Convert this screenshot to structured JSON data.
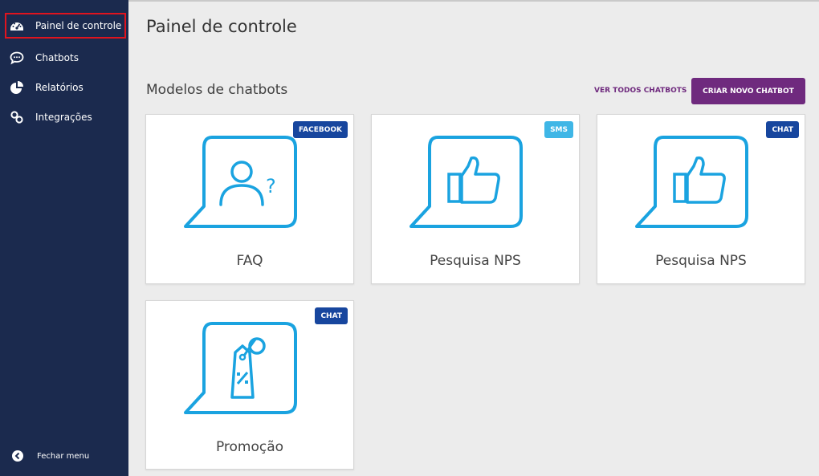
{
  "sidebar": {
    "items": [
      {
        "label": "Painel de controle",
        "icon": "dashboard-icon",
        "active": true
      },
      {
        "label": "Chatbots",
        "icon": "chat-bubble-icon",
        "active": false
      },
      {
        "label": "Relatórios",
        "icon": "pie-chart-icon",
        "active": false
      },
      {
        "label": "Integrações",
        "icon": "link-icon",
        "active": false
      }
    ],
    "close_menu": "Fechar menu"
  },
  "main": {
    "title": "Painel de controle",
    "section_title": "Modelos de chatbots",
    "view_all": "VER TODOS CHATBOTS",
    "create_new": "CRIAR NOVO CHATBOT"
  },
  "cards": [
    {
      "label": "FAQ",
      "badge": "FACEBOOK",
      "badge_color": "#17469e",
      "icon": "faq-user-question-icon"
    },
    {
      "label": "Pesquisa NPS",
      "badge": "SMS",
      "badge_color": "#3fb6e6",
      "icon": "thumbs-up-icon"
    },
    {
      "label": "Pesquisa NPS",
      "badge": "CHAT",
      "badge_color": "#17469e",
      "icon": "thumbs-up-icon"
    },
    {
      "label": "Promoção",
      "badge": "CHAT",
      "badge_color": "#17469e",
      "icon": "price-tag-icon"
    }
  ],
  "colors": {
    "sidebar_bg": "#1b2a4e",
    "accent_purple": "#6f2a7e",
    "icon_blue": "#1aa3e0",
    "active_border": "#e0141e"
  }
}
